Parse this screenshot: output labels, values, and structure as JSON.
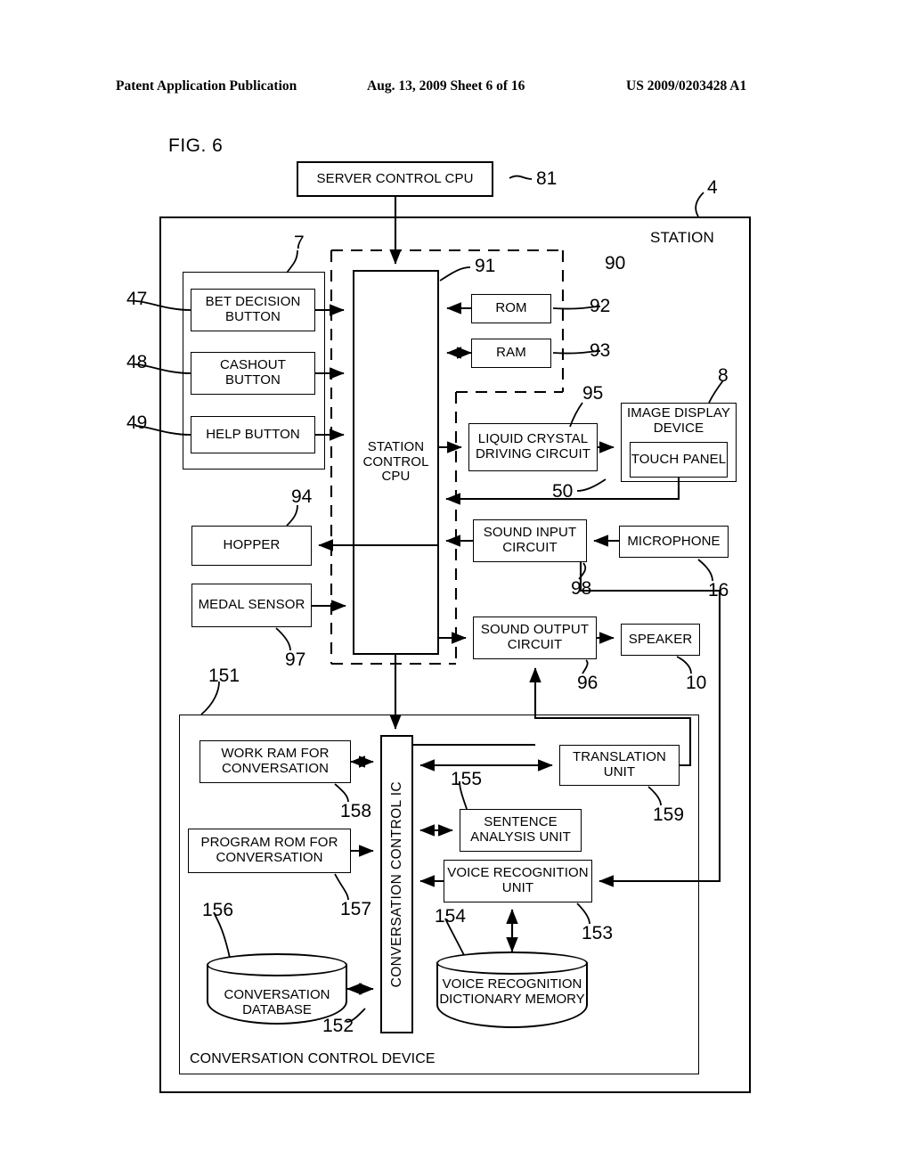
{
  "header": {
    "publication": "Patent Application Publication",
    "date_sheet": "Aug. 13, 2009  Sheet 6 of 16",
    "patent_number": "US 2009/0203428 A1"
  },
  "figure": {
    "label": "FIG. 6",
    "title_block": "SERVER CONTROL CPU",
    "station_label": "STATION",
    "conversation_device_label": "CONVERSATION CONTROL DEVICE"
  },
  "blocks": {
    "server_control_cpu": "SERVER CONTROL CPU",
    "bet_decision_button": "BET DECISION BUTTON",
    "cashout_button": "CASHOUT BUTTON",
    "help_button": "HELP BUTTON",
    "station_control_cpu": "STATION CONTROL CPU",
    "rom": "ROM",
    "ram": "RAM",
    "liquid_crystal_driving_circuit": "LIQUID CRYSTAL DRIVING CIRCUIT",
    "image_display_device": "IMAGE DISPLAY DEVICE",
    "touch_panel": "TOUCH PANEL",
    "hopper": "HOPPER",
    "medal_sensor": "MEDAL SENSOR",
    "sound_input_circuit": "SOUND INPUT CIRCUIT",
    "microphone": "MICROPHONE",
    "sound_output_circuit": "SOUND OUTPUT CIRCUIT",
    "speaker": "SPEAKER",
    "work_ram_for_conversation": "WORK RAM FOR CONVERSATION",
    "program_rom_for_conversation": "PROGRAM ROM FOR CONVERSATION",
    "conversation_control_ic": "CONVERSATION CONTROL IC",
    "translation_unit": "TRANSLATION UNIT",
    "sentence_analysis_unit": "SENTENCE ANALYSIS UNIT",
    "voice_recognition_unit": "VOICE RECOGNITION UNIT",
    "conversation_database": "CONVERSATION DATABASE",
    "voice_recognition_dictionary_memory": "VOICE RECOGNITION DICTIONARY MEMORY"
  },
  "reference_numerals": {
    "n4": "4",
    "n7": "7",
    "n8": "8",
    "n10": "10",
    "n16": "16",
    "n47": "47",
    "n48": "48",
    "n49": "49",
    "n50": "50",
    "n81": "81",
    "n90": "90",
    "n91": "91",
    "n92": "92",
    "n93": "93",
    "n94": "94",
    "n95": "95",
    "n96": "96",
    "n97": "97",
    "n98": "98",
    "n151": "151",
    "n152": "152",
    "n153": "153",
    "n154": "154",
    "n155": "155",
    "n156": "156",
    "n157": "157",
    "n158": "158",
    "n159": "159"
  },
  "diagram_structure": {
    "type": "block-diagram",
    "description": "Gaming station block diagram with server control CPU feeding a station control CPU, memory (ROM/RAM), display, audio and a conversation control device subsystem.",
    "groups": [
      {
        "id": "4",
        "label": "STATION",
        "kind": "solid-frame"
      },
      {
        "id": "7",
        "label": "button group",
        "kind": "solid-frame"
      },
      {
        "id": "90",
        "label": "memory block",
        "kind": "dashed-frame"
      },
      {
        "id": "95",
        "label": "driving/audio dashed region",
        "kind": "dashed-frame"
      },
      {
        "id": "151",
        "label": "CONVERSATION CONTROL DEVICE",
        "kind": "solid-frame"
      }
    ],
    "connections": [
      {
        "from": "SERVER CONTROL CPU",
        "to": "STATION CONTROL CPU",
        "dir": "one-way"
      },
      {
        "from": "BET DECISION BUTTON",
        "to": "STATION CONTROL CPU",
        "dir": "one-way"
      },
      {
        "from": "CASHOUT BUTTON",
        "to": "STATION CONTROL CPU",
        "dir": "one-way"
      },
      {
        "from": "HELP BUTTON",
        "to": "STATION CONTROL CPU",
        "dir": "one-way"
      },
      {
        "from": "ROM",
        "to": "STATION CONTROL CPU",
        "dir": "one-way"
      },
      {
        "from": "RAM",
        "to": "STATION CONTROL CPU",
        "dir": "two-way"
      },
      {
        "from": "STATION CONTROL CPU",
        "to": "LIQUID CRYSTAL DRIVING CIRCUIT",
        "dir": "one-way"
      },
      {
        "from": "LIQUID CRYSTAL DRIVING CIRCUIT",
        "to": "IMAGE DISPLAY DEVICE",
        "dir": "one-way"
      },
      {
        "from": "TOUCH PANEL",
        "to": "STATION CONTROL CPU",
        "dir": "one-way"
      },
      {
        "from": "STATION CONTROL CPU",
        "to": "HOPPER",
        "dir": "one-way"
      },
      {
        "from": "MEDAL SENSOR",
        "to": "STATION CONTROL CPU",
        "dir": "one-way"
      },
      {
        "from": "MICROPHONE",
        "to": "SOUND INPUT CIRCUIT",
        "dir": "one-way"
      },
      {
        "from": "SOUND INPUT CIRCUIT",
        "to": "STATION CONTROL CPU",
        "dir": "one-way"
      },
      {
        "from": "SOUND INPUT CIRCUIT",
        "to": "VOICE RECOGNITION UNIT",
        "dir": "one-way"
      },
      {
        "from": "STATION CONTROL CPU",
        "to": "SOUND OUTPUT CIRCUIT",
        "dir": "one-way"
      },
      {
        "from": "SOUND OUTPUT CIRCUIT",
        "to": "SPEAKER",
        "dir": "one-way"
      },
      {
        "from": "TRANSLATION UNIT",
        "to": "SOUND OUTPUT CIRCUIT",
        "dir": "one-way"
      },
      {
        "from": "STATION CONTROL CPU",
        "to": "CONVERSATION CONTROL IC",
        "dir": "one-way"
      },
      {
        "from": "WORK RAM FOR CONVERSATION",
        "to": "CONVERSATION CONTROL IC",
        "dir": "two-way"
      },
      {
        "from": "PROGRAM ROM FOR CONVERSATION",
        "to": "CONVERSATION CONTROL IC",
        "dir": "one-way"
      },
      {
        "from": "CONVERSATION CONTROL IC",
        "to": "TRANSLATION UNIT",
        "dir": "two-way"
      },
      {
        "from": "CONVERSATION CONTROL IC",
        "to": "SENTENCE ANALYSIS UNIT",
        "dir": "two-way"
      },
      {
        "from": "VOICE RECOGNITION UNIT",
        "to": "CONVERSATION CONTROL IC",
        "dir": "one-way"
      },
      {
        "from": "VOICE RECOGNITION DICTIONARY MEMORY",
        "to": "VOICE RECOGNITION UNIT",
        "dir": "two-way"
      },
      {
        "from": "CONVERSATION DATABASE",
        "to": "CONVERSATION CONTROL IC",
        "dir": "two-way"
      }
    ]
  }
}
